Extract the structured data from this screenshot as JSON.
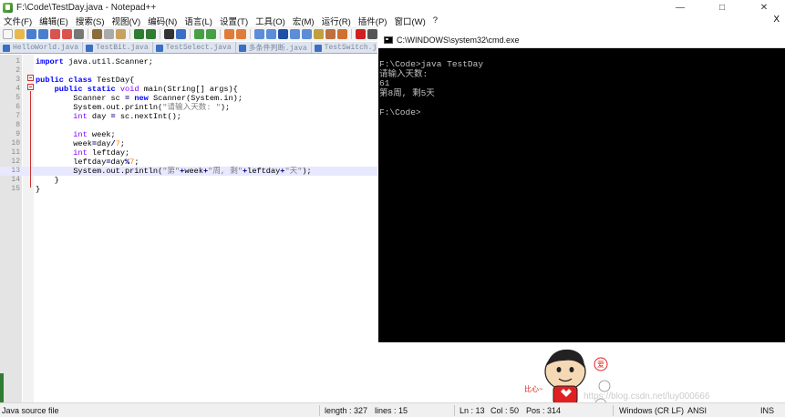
{
  "window": {
    "title": "F:\\Code\\TestDay.java - Notepad++",
    "controls": [
      "—",
      "□",
      "✕"
    ]
  },
  "menu": {
    "items": [
      "文件(F)",
      "编辑(E)",
      "搜索(S)",
      "视图(V)",
      "编码(N)",
      "语言(L)",
      "设置(T)",
      "工具(O)",
      "宏(M)",
      "运行(R)",
      "插件(P)",
      "窗口(W)",
      "?"
    ],
    "close": "X"
  },
  "tabs": [
    {
      "label": "HelloWorld.java"
    },
    {
      "label": "TestBit.java"
    },
    {
      "label": "TestSelect.java"
    },
    {
      "label": "多条件判断.java"
    },
    {
      "label": "TestSwitch.java"
    }
  ],
  "editor": {
    "lines": [
      {
        "n": "1",
        "tokens": [
          [
            "kw",
            "import"
          ],
          [
            "pl",
            " java.util.Scanner;"
          ]
        ]
      },
      {
        "n": "2",
        "tokens": []
      },
      {
        "n": "3",
        "tokens": [
          [
            "kw",
            "public"
          ],
          [
            "pl",
            " "
          ],
          [
            "kw",
            "class"
          ],
          [
            "pl",
            " TestDay{"
          ]
        ]
      },
      {
        "n": "4",
        "tokens": [
          [
            "pl",
            "    "
          ],
          [
            "kw",
            "public"
          ],
          [
            "pl",
            " "
          ],
          [
            "kw",
            "static"
          ],
          [
            "pl",
            " "
          ],
          [
            "kt",
            "void"
          ],
          [
            "pl",
            " main(String[] args){"
          ]
        ]
      },
      {
        "n": "5",
        "tokens": [
          [
            "pl",
            "        Scanner sc "
          ],
          [
            "op",
            "="
          ],
          [
            "pl",
            " "
          ],
          [
            "kw",
            "new"
          ],
          [
            "pl",
            " Scanner(System.in);"
          ]
        ]
      },
      {
        "n": "6",
        "tokens": [
          [
            "pl",
            "        System.out.println("
          ],
          [
            "st",
            "\"请输入天数: \""
          ],
          [
            "pl",
            ");"
          ]
        ]
      },
      {
        "n": "7",
        "tokens": [
          [
            "pl",
            "        "
          ],
          [
            "kt",
            "int"
          ],
          [
            "pl",
            " day "
          ],
          [
            "op",
            "="
          ],
          [
            "pl",
            " sc.nextInt();"
          ]
        ]
      },
      {
        "n": "8",
        "tokens": []
      },
      {
        "n": "9",
        "tokens": [
          [
            "pl",
            "        "
          ],
          [
            "kt",
            "int"
          ],
          [
            "pl",
            " week;"
          ]
        ]
      },
      {
        "n": "10",
        "tokens": [
          [
            "pl",
            "        week"
          ],
          [
            "op",
            "="
          ],
          [
            "pl",
            "day"
          ],
          [
            "op",
            "/"
          ],
          [
            "nm",
            "7"
          ],
          [
            "pl",
            ";"
          ]
        ]
      },
      {
        "n": "11",
        "tokens": [
          [
            "pl",
            "        "
          ],
          [
            "kt",
            "int"
          ],
          [
            "pl",
            " leftday;"
          ]
        ]
      },
      {
        "n": "12",
        "tokens": [
          [
            "pl",
            "        leftday"
          ],
          [
            "op",
            "="
          ],
          [
            "pl",
            "day"
          ],
          [
            "op",
            "%"
          ],
          [
            "nm",
            "7"
          ],
          [
            "pl",
            ";"
          ]
        ]
      },
      {
        "n": "13",
        "tokens": [
          [
            "pl",
            "        System.out.println("
          ],
          [
            "st",
            "\"第\""
          ],
          [
            "op",
            "+"
          ],
          [
            "pl",
            "week"
          ],
          [
            "op",
            "+"
          ],
          [
            "st",
            "\"周, 剩\""
          ],
          [
            "op",
            "+"
          ],
          [
            "pl",
            "leftday"
          ],
          [
            "op",
            "+"
          ],
          [
            "st",
            "\"天\""
          ],
          [
            "pl",
            ");"
          ]
        ]
      },
      {
        "n": "14",
        "tokens": [
          [
            "pl",
            "    }"
          ]
        ]
      },
      {
        "n": "15",
        "tokens": [
          [
            "pl",
            "}"
          ]
        ]
      }
    ],
    "current_line": "13"
  },
  "console": {
    "title": "C:\\WINDOWS\\system32\\cmd.exe",
    "lines": [
      "F:\\Code>java TestDay",
      "请输入天数:",
      "61",
      "第8周, 剩5天",
      "",
      "F:\\Code>"
    ]
  },
  "mascot": {
    "speech": "比心~",
    "badge": "爱",
    "watermark": "https://blog.csdn.net/luy000666"
  },
  "status": {
    "filetype": "Java source file",
    "length": "length : 327",
    "lines": "lines : 15",
    "ln": "Ln : 13",
    "col": "Col : 50",
    "pos": "Pos : 314",
    "eol": "Windows (CR LF)",
    "encoding": "ANSI",
    "mode": "INS"
  }
}
